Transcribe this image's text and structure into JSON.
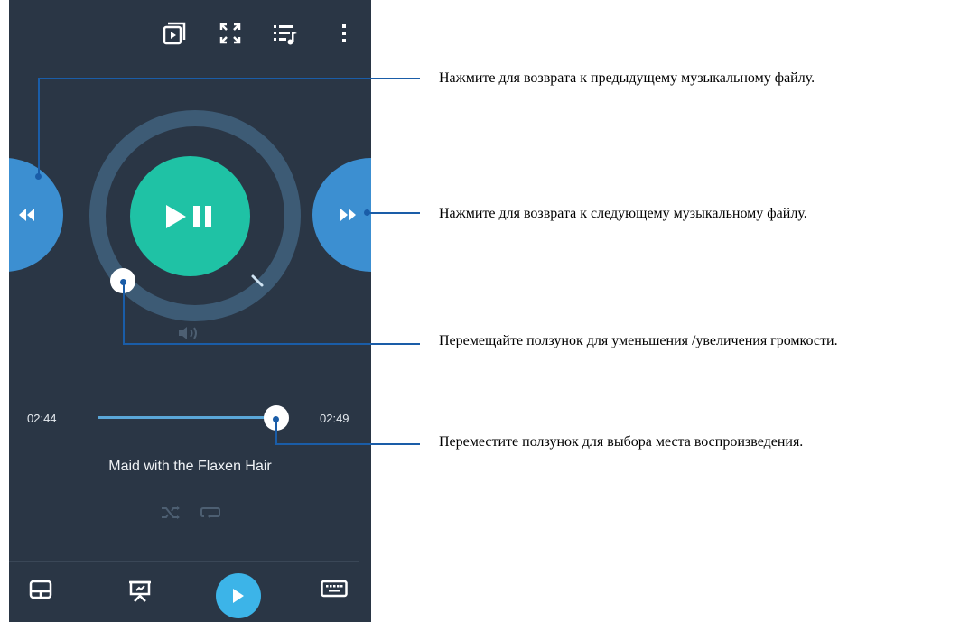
{
  "colors": {
    "panel_bg": "#2a3645",
    "side_button": "#3c8fd1",
    "play_button": "#1fc2a5",
    "ring": "#3d5b75",
    "callout_line": "#1a5da8",
    "nav_play": "#3cb4e8"
  },
  "toolbar": {
    "icons": [
      "cast-icon",
      "fullscreen-icon",
      "playlist-icon",
      "more-vert-icon"
    ]
  },
  "player": {
    "elapsed": "02:44",
    "remaining": "02:49",
    "seek_progress": 0.95,
    "volume_level": 0.0,
    "song_title": "Maid with the Flaxen Hair"
  },
  "bottom_nav": {
    "icons": [
      "touchpad-icon",
      "presentation-icon",
      "play-icon",
      "keyboard-icon"
    ]
  },
  "callouts": [
    {
      "text": "Нажмите для возврата к предыдущему музыкальному файлу."
    },
    {
      "text": "Нажмите для возврата к следующему музыкальному файлу."
    },
    {
      "text": "Перемещайте ползунок для уменьшения /увеличения громкости."
    },
    {
      "text": "Переместите ползунок для выбора места воспроизведения."
    }
  ]
}
